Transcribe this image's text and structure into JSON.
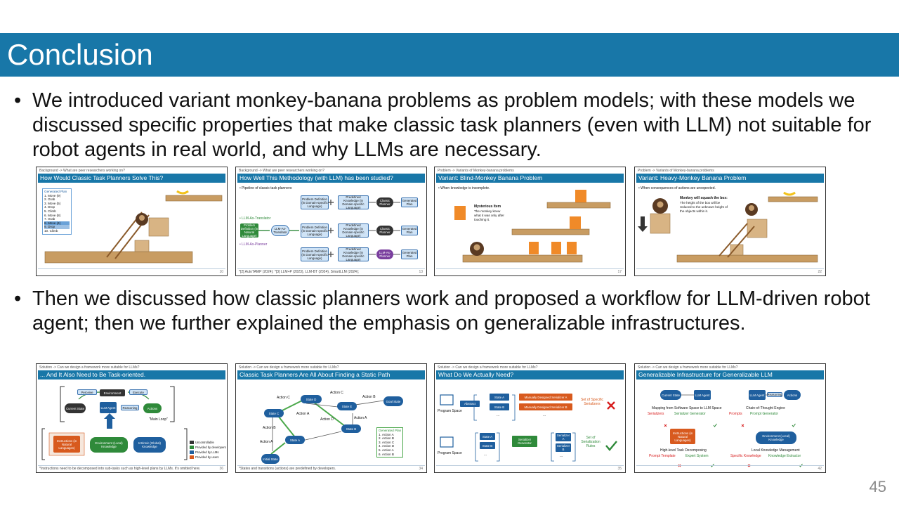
{
  "slide": {
    "title": "Conclusion",
    "number": "45",
    "bullets": [
      "We introduced variant monkey-banana problems as problem models; with these models we discussed specific properties that make classic task planners (even with LLM) not suitable for robot agents in real world, and why LLMs are necessary.",
      "Then we discussed how classic planners work and proposed a workflow for LLM-driven robot agent; then we further explained the emphasis on generalizable infrastructures."
    ],
    "bullet_glyph": "•"
  },
  "colors": {
    "title_bar": "#1877a8",
    "title_text": "#ffffff",
    "page_number": "#8a8a8a"
  },
  "thumbnails": [
    {
      "crumb": "Background -> What are peer researchers working on?",
      "title": "How Would Classic Task Planners Solve This?",
      "page": "10",
      "plan_heading": "Generated Plan",
      "plan": [
        "1.  Move (9)",
        "2.  Grab",
        "3.  Move (5)",
        "4.  Drop",
        "5.  Climb",
        "6.  Move (8)",
        "7.  Grab",
        "8.  Move (4)",
        "9.  Drop",
        "10. Climb"
      ]
    },
    {
      "crumb": "Background -> What are peer researchers working on?",
      "title": "How Well This Methodology (with LLM) has been studied?",
      "page": "13",
      "intro": "• Pipeline of classic task planners:",
      "label_translator": "• LLM-As-Translator",
      "label_planner": "• LLM-As-Planner",
      "box_problem": "Problem Definition (in Domain-specific Language)",
      "box_knowledge": "Predefined Knowledge (in Domain-specific Language)",
      "box_classic": "Classic Planner",
      "box_plan": "Generated Plan",
      "box_nl": "Problem Definition (in Natural Language)",
      "box_translator": "LLM-As-Translator",
      "box_llm_planner": "LLM-As-Planner",
      "footnote": "*[2] AutoTAMP (2024); *[3] LLM+P (2023), LLM-BT (2024), SmartLLM (2024);"
    },
    {
      "crumb": "Problem -> Variants of Monkey-banana problems",
      "title": "Variant: Blind-Monkey Banana Problem",
      "page": "17",
      "bullet": "• When knowledge is incomplete.",
      "callout_title": "Mysterious Item",
      "callout_text": "The monkey knew what it was only after touching it."
    },
    {
      "crumb": "Problem -> Variants of Monkey-banana problems",
      "title": "Variant: Heavy-Monkey Banana Problem",
      "page": "22",
      "bullet": "• When consequences of actions are unexpected.",
      "callout_title": "Monkey will squash the box:",
      "callout_text": "The height of the box will be reduced to the unknown height of the objects within it."
    },
    {
      "crumb": "Solution -> Can we design a framework more suitable for LLMs?",
      "title": "... And It Also Need to Be Task-oriented.",
      "page": "36",
      "nodes": {
        "perceive": "Perceive",
        "environment": "Environment",
        "execute": "Execute",
        "current_state": "Current State",
        "llm_agent": "LLM Agent",
        "reasoning": "Reasoning",
        "actions": "Actions",
        "main_loop": "\"Main Loop\"",
        "instructions": "Instructions (in Natural Languages)",
        "env_knowledge": "Environment (Local) Knowledge",
        "intrinsic": "Intrinsic (Global) Knowledge"
      },
      "legend": [
        "Uncontrollable",
        "Provided by developers",
        "Provided by LLMs",
        "Provided by users"
      ],
      "footnote": "*Instructions need to be decomposed into sub-tasks such as high-level plans by LLMs. It's omitted here."
    },
    {
      "crumb": "Solution -> Can we design a framework more suitable for LLMs?",
      "title": "Classic Task Planners Are All About Finding a Static Path",
      "page": "34",
      "states": {
        "initial": "Initial State",
        "a": "State A",
        "b": "State B",
        "c": "State C",
        "d": "State D",
        "e": "State E",
        "goal": "Goal State"
      },
      "actions": {
        "a": "Action A",
        "b": "Action B",
        "c": "Action C",
        "d": "Action D"
      },
      "plan_heading": "Generated Plan",
      "plan": [
        "1.  Action A",
        "2.  Action B",
        "3.  Action C",
        "4.  Action D",
        "5.  Action A",
        "6.  Action B"
      ],
      "footnote": "*States and transitions (actions) are predefined by developers."
    },
    {
      "crumb": "Solution -> Can we design a framework more suitable for LLMs?",
      "title": "What Do We Actually Need?",
      "page": "35",
      "program_space": "Program Space",
      "abstract": "Abstract",
      "state_a": "State A",
      "state_b": "State B",
      "ellipsis": "...",
      "serializer_a": "Manually Designed Serializer A",
      "serializer_b": "Manually Designed Serializer B",
      "specific": "Set of Specific Serializers",
      "generator": "Serializer Generator",
      "ser_a": "Serializer A",
      "ser_b": "Serializer B",
      "rules": "Set of Serialization Rules"
    },
    {
      "crumb": "Solution -> Can we design a framework more suitable for LLMs?",
      "title": "Generalizable Infrastructure for Generalizable LLM",
      "page": "42",
      "current_state": "Current State",
      "llm_agent": "LLM Agent",
      "reasoning": "Reasoning",
      "actions": "Actions",
      "mapping": "Mapping from Software Space to LLM Space",
      "serializers": "Serializers",
      "serializer_generator": "Serializer Generator",
      "cot": "Chain-of-Thought Engine",
      "prompts": "Prompts",
      "prompt_generator": "Prompt Generator",
      "instructions": "Instructions (in Natural Languages)",
      "env_knowledge": "Environment (Local) Knowledge",
      "decomposing": "High-level Task Decomposing",
      "prompt_template": "Prompt Template",
      "expert_system": "Expert System",
      "local_mgmt": "Local Knowledge Management",
      "specific_knowledge": "Specific Knowledge",
      "knowledge_extractor": "Knowledge Extractor"
    }
  ]
}
